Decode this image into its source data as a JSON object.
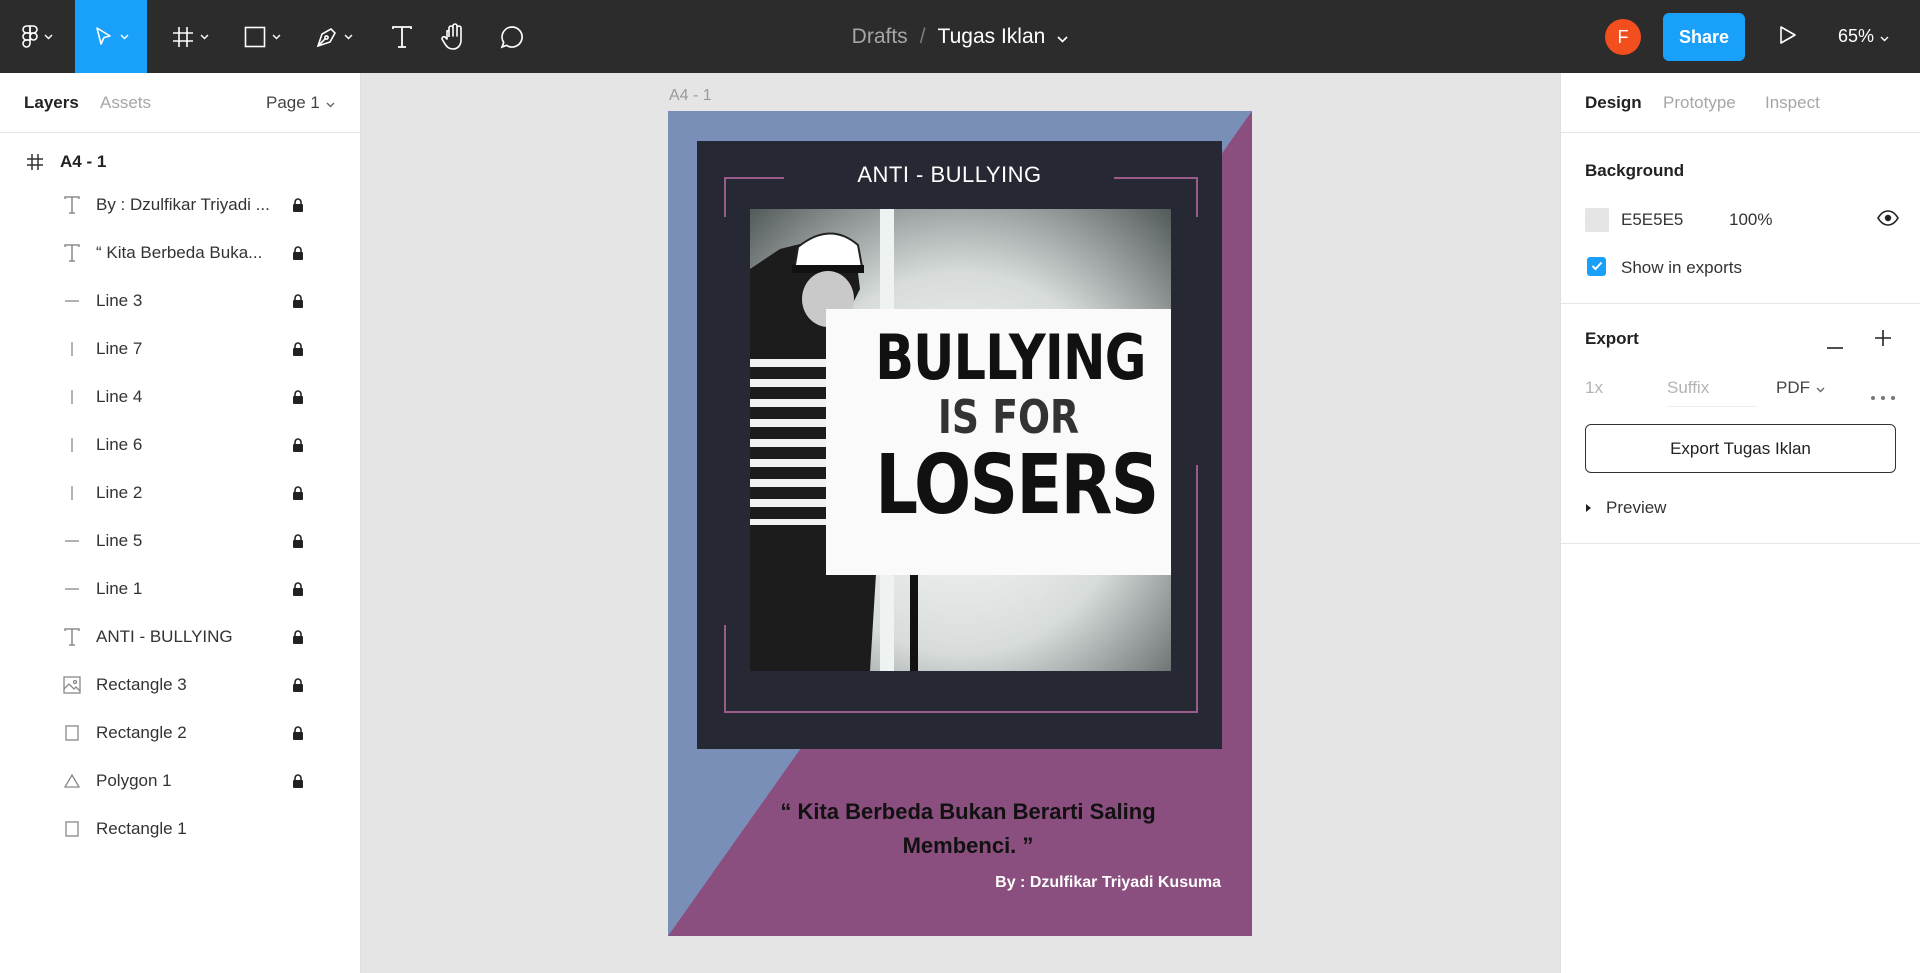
{
  "toolbar": {
    "tools": [
      {
        "name": "main-menu",
        "icon": "figma-logo-icon"
      },
      {
        "name": "move",
        "icon": "cursor-arrow-icon",
        "active": true
      },
      {
        "name": "frame",
        "icon": "frame-hash-icon"
      },
      {
        "name": "shape",
        "icon": "rectangle-icon"
      },
      {
        "name": "pen",
        "icon": "pen-nib-icon"
      },
      {
        "name": "text",
        "icon": "text-T-icon"
      },
      {
        "name": "hand",
        "icon": "hand-icon"
      },
      {
        "name": "comment",
        "icon": "comment-bubble-icon"
      }
    ],
    "breadcrumb": {
      "parent": "Drafts",
      "separator": "/",
      "file": "Tugas Iklan"
    },
    "avatar_initial": "F",
    "share_label": "Share",
    "zoom": "65%",
    "accent": "#18a0fb",
    "avatar_color": "#f24e1e"
  },
  "left_panel": {
    "tabs": {
      "layers": "Layers",
      "assets": "Assets"
    },
    "page": "Page 1",
    "root": {
      "label": "A4 - 1",
      "icon": "frame-hash-icon"
    },
    "layers": [
      {
        "label": "By : Dzulfikar Triyadi ...",
        "icon": "text-icon",
        "locked": true
      },
      {
        "label": "“ Kita Berbeda Buka...",
        "icon": "text-icon",
        "locked": true
      },
      {
        "label": "Line 3",
        "icon": "line-horizontal-icon",
        "locked": true
      },
      {
        "label": "Line 7",
        "icon": "line-vertical-icon",
        "locked": true
      },
      {
        "label": "Line 4",
        "icon": "line-vertical-icon",
        "locked": true
      },
      {
        "label": "Line 6",
        "icon": "line-vertical-icon",
        "locked": true
      },
      {
        "label": "Line 2",
        "icon": "line-vertical-icon",
        "locked": true
      },
      {
        "label": "Line 5",
        "icon": "line-horizontal-icon",
        "locked": true
      },
      {
        "label": "Line 1",
        "icon": "line-horizontal-icon",
        "locked": true
      },
      {
        "label": "ANTI - BULLYING",
        "icon": "text-icon",
        "locked": true
      },
      {
        "label": "Rectangle 3",
        "icon": "image-icon",
        "locked": true
      },
      {
        "label": "Rectangle 2",
        "icon": "rectangle-icon",
        "locked": true
      },
      {
        "label": "Polygon 1",
        "icon": "triangle-icon",
        "locked": true
      },
      {
        "label": "Rectangle 1",
        "icon": "rectangle-icon",
        "locked": false
      }
    ]
  },
  "canvas": {
    "frame_label": "A4 - 1",
    "poster": {
      "headline": "ANTI - BULLYING",
      "photo_text": [
        "BULLYING",
        "IS FOR",
        "LOSERS"
      ],
      "quote": "“ Kita Berbeda Bukan Berarti Saling Membenci. ”",
      "byline": "By : Dzulfikar Triyadi Kusuma",
      "colors": {
        "blue": "#7a8fb8",
        "purple": "#8a4e7f",
        "dark": "#262833",
        "accent_line": "#9b5c8c"
      }
    },
    "help_label": "?"
  },
  "right_panel": {
    "tabs": {
      "design": "Design",
      "prototype": "Prototype",
      "inspect": "Inspect"
    },
    "background": {
      "title": "Background",
      "hex": "E5E5E5",
      "opacity": "100%",
      "show_in_exports": "Show in exports",
      "checked": true
    },
    "export": {
      "title": "Export",
      "scale": "1x",
      "suffix_placeholder": "Suffix",
      "format": "PDF",
      "button": "Export Tugas Iklan",
      "preview": "Preview"
    }
  }
}
